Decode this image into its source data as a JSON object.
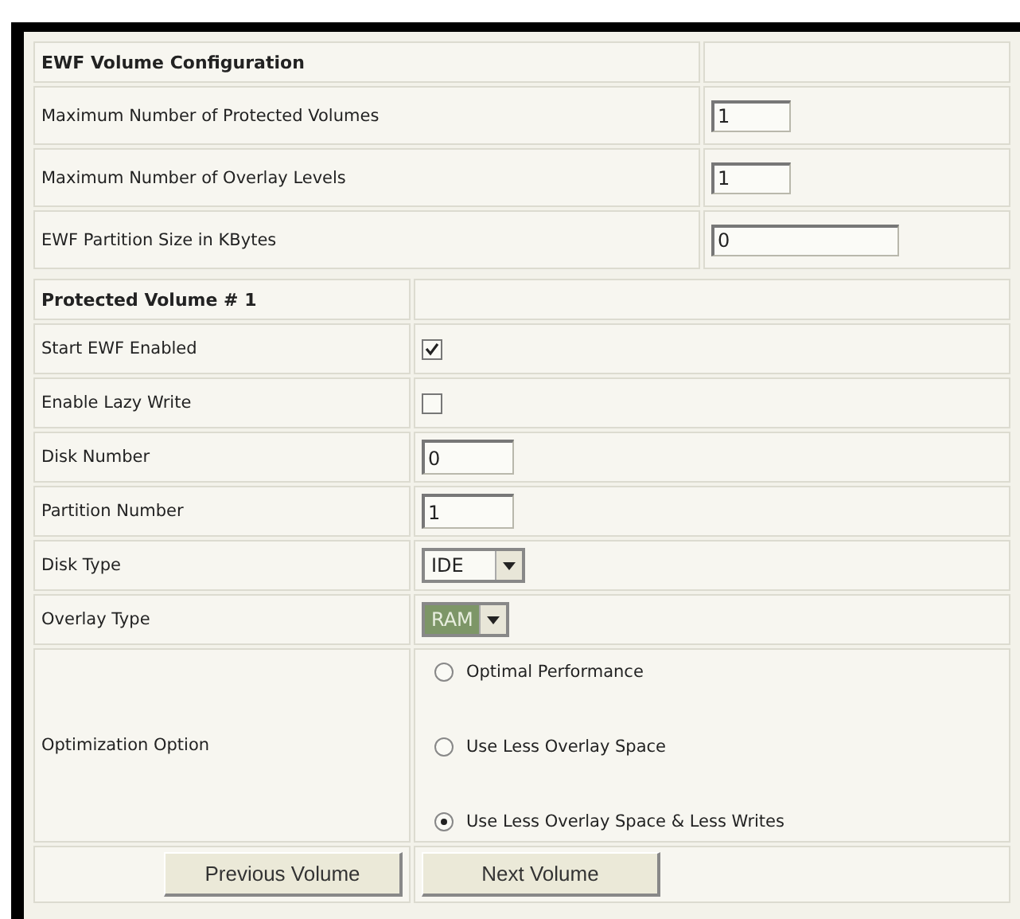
{
  "volume_configuration": {
    "title": "EWF Volume Configuration",
    "rows": [
      {
        "label": "Maximum Number of Protected Volumes",
        "value": "1"
      },
      {
        "label": "Maximum Number of Overlay Levels",
        "value": "1"
      },
      {
        "label": "EWF Partition Size in KBytes",
        "value": "0"
      }
    ]
  },
  "protected_volume": {
    "title": "Protected Volume # 1",
    "rows": [
      {
        "kind": "checkbox",
        "label": "Start EWF Enabled",
        "checked": true
      },
      {
        "kind": "checkbox",
        "label": "Enable Lazy Write",
        "checked": false
      },
      {
        "kind": "text",
        "label": "Disk Number",
        "value": "0"
      },
      {
        "kind": "text",
        "label": "Partition Number",
        "value": "1"
      },
      {
        "kind": "select",
        "label": "Disk Type",
        "value": "IDE",
        "focused": false
      },
      {
        "kind": "select",
        "label": "Overlay Type",
        "value": "RAM",
        "focused": true
      },
      {
        "kind": "radio",
        "label": "Optimization Option",
        "options": [
          {
            "label": "Optimal Performance",
            "selected": false
          },
          {
            "label": "Use Less Overlay Space",
            "selected": false
          },
          {
            "label": "Use Less Overlay Space & Less Writes",
            "selected": true
          }
        ]
      }
    ]
  },
  "buttons": [
    "Previous Volume",
    "Next Volume"
  ]
}
